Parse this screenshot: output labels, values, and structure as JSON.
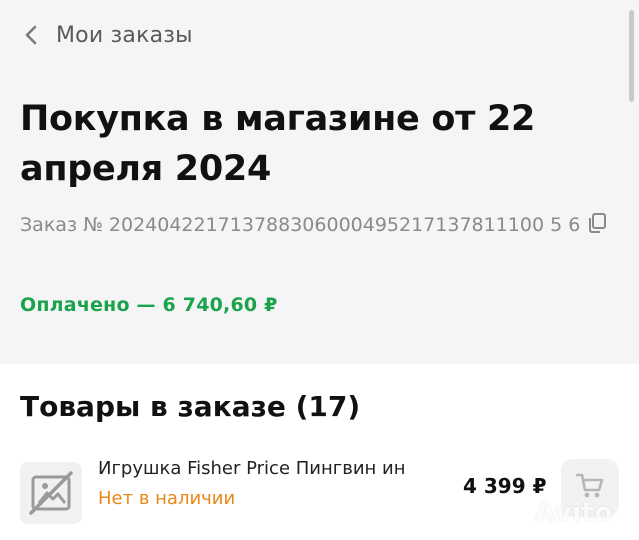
{
  "nav": {
    "back_label": "Мои заказы"
  },
  "order": {
    "title": "Покупка в магазине от 22 апреля 2024",
    "number_line": "Заказ № 202404221713788306000495217137811100 5 6",
    "payment_status": "Оплачено — 6 740,60 ₽"
  },
  "products": {
    "heading": "Товары в заказе (17)",
    "items": [
      {
        "name": "Игрушка Fisher Price Пингвин ин",
        "stock_status": "Нет в наличии",
        "price": "4 399 ₽"
      }
    ]
  },
  "watermark": "Avito",
  "colors": {
    "paid_green": "#1aa34a",
    "stock_orange": "#e8881a"
  },
  "icons": [
    "chevron-left-icon",
    "copy-icon",
    "no-image-icon",
    "cart-icon"
  ]
}
